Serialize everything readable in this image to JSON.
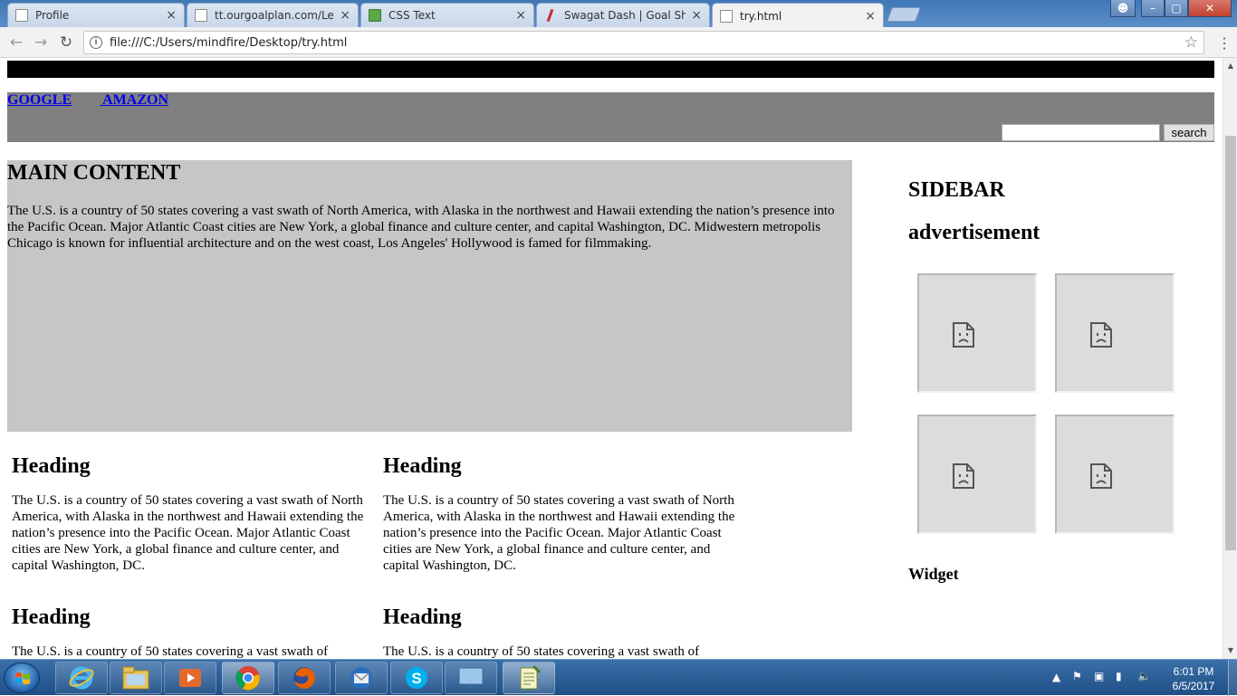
{
  "browser": {
    "tabs": [
      {
        "title": "Profile",
        "icon": "document-icon"
      },
      {
        "title": "tt.ourgoalplan.com/Lear",
        "icon": "document-icon"
      },
      {
        "title": "CSS Text",
        "icon": "w3schools-icon"
      },
      {
        "title": "Swagat Dash | Goal Shee",
        "icon": "goalplan-icon"
      },
      {
        "title": "try.html",
        "icon": "document-icon"
      }
    ],
    "active_tab": "try.html",
    "url": "file:///C:/Users/mindfire/Desktop/try.html",
    "close_glyph": "×"
  },
  "page": {
    "nav": {
      "google": "GOOGLE",
      "amazon": " AMAZON"
    },
    "search": {
      "button": "search",
      "value": ""
    },
    "main": {
      "title": "MAIN CONTENT",
      "text": "The U.S. is a country of 50 states covering a vast swath of North America, with Alaska in the northwest and Hawaii extending the nation’s presence into the Pacific Ocean. Major Atlantic Coast cities are New York, a global finance and culture center, and capital Washington, DC. Midwestern metropolis Chicago is known for influential architecture and on the west coast, Los Angeles' Hollywood is famed for filmmaking."
    },
    "articles": [
      {
        "heading": "Heading",
        "text": "The U.S. is a country of 50 states covering a vast swath of North America, with Alaska in the northwest and Hawaii extending the nation’s presence into the Pacific Ocean. Major Atlantic Coast cities are New York, a global finance and culture center, and capital Washington, DC."
      },
      {
        "heading": "Heading",
        "text": "The U.S. is a country of 50 states covering a vast swath of North America, with Alaska in the northwest and Hawaii extending the nation’s presence into the Pacific Ocean. Major Atlantic Coast cities are New York, a global finance and culture center, and capital Washington, DC."
      },
      {
        "heading": "Heading",
        "text": "The U.S. is a country of 50 states covering a vast swath of"
      },
      {
        "heading": "Heading",
        "text": "The U.S. is a country of 50 states covering a vast swath of"
      }
    ],
    "sidebar": {
      "title": "SIDEBAR",
      "ad_title": "advertisement",
      "ad_images": [
        "broken-image-icon",
        "broken-image-icon",
        "broken-image-icon",
        "broken-image-icon"
      ],
      "widget_title": "Widget"
    }
  },
  "taskbar": {
    "apps": [
      "internet-explorer-icon",
      "file-explorer-icon",
      "media-player-icon",
      "chrome-icon",
      "firefox-icon",
      "thunderbird-icon",
      "skype-icon",
      "remote-desktop-icon",
      "notepad-icon"
    ],
    "time": "6:01 PM",
    "date": "6/5/2017"
  },
  "colors": {
    "link": "#0000ee",
    "nav_band": "#808080",
    "main_bg": "#c6c6c6",
    "top_bar": "#000000"
  }
}
